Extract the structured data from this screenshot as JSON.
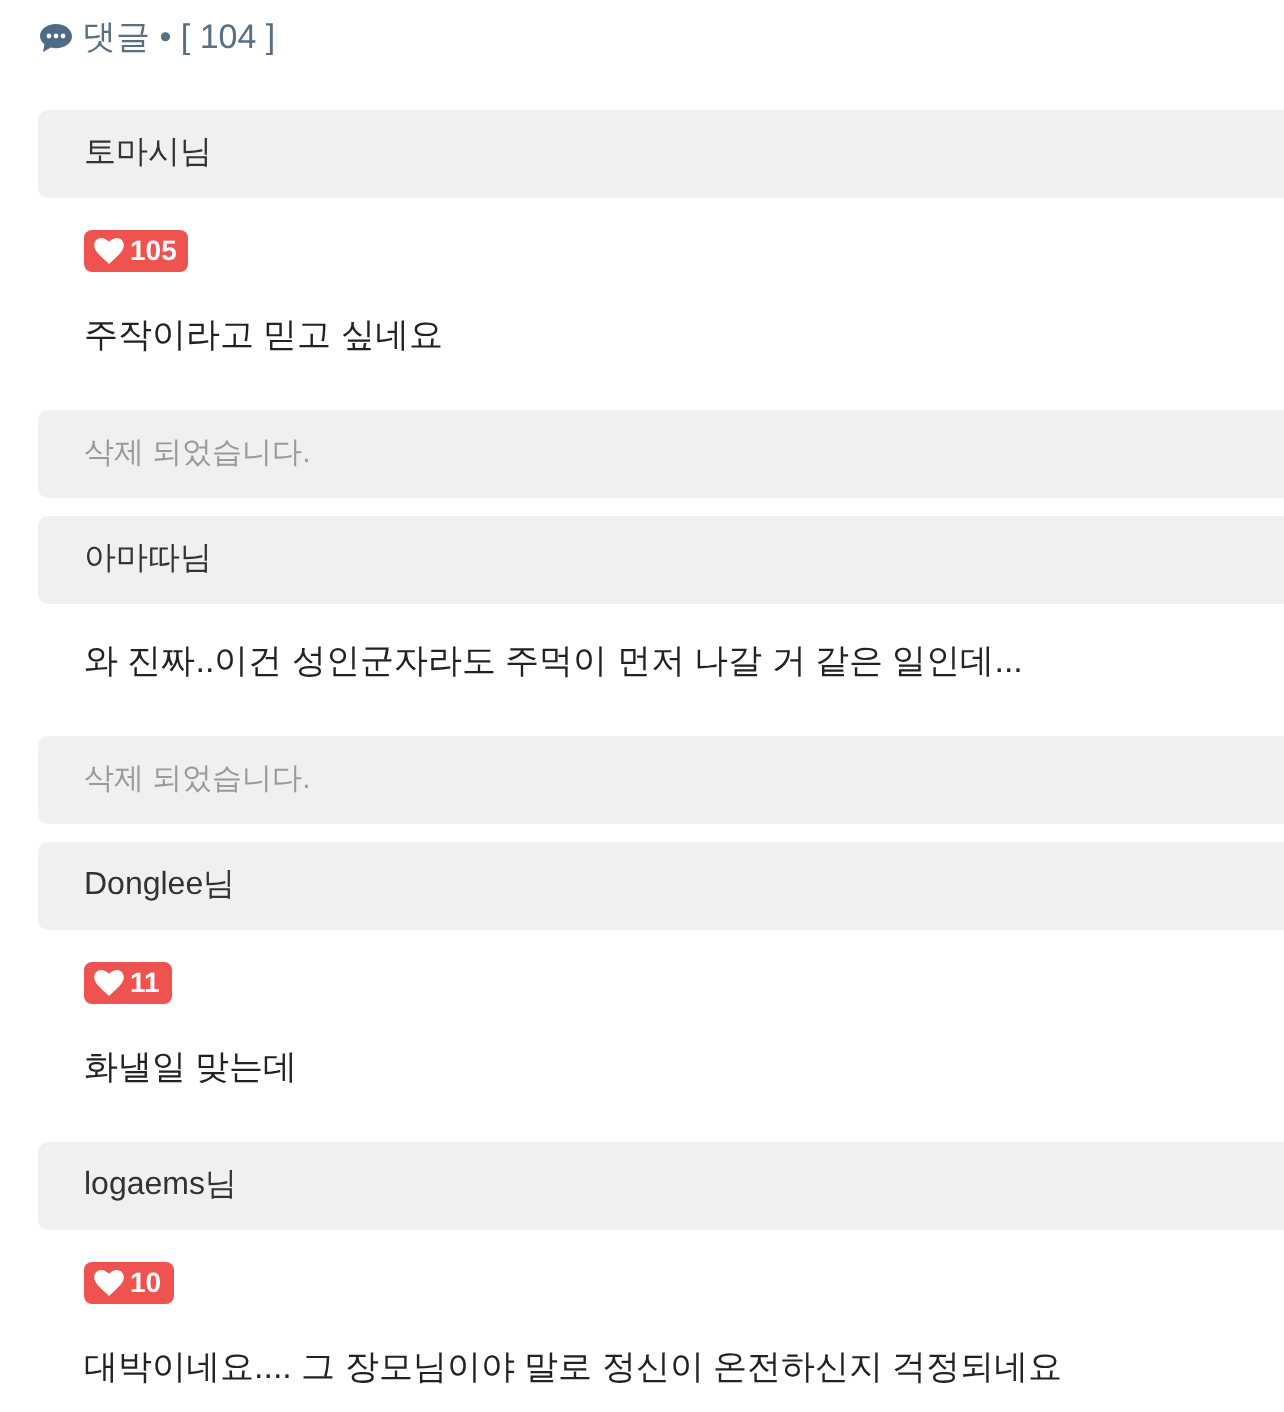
{
  "header": {
    "label": "댓글 • [ 104 ]"
  },
  "comments": [
    {
      "kind": "comment",
      "author": "토마시님",
      "likes": "105",
      "body": "주작이라고 믿고 싶네요"
    },
    {
      "kind": "deleted",
      "text": "삭제 되었습니다."
    },
    {
      "kind": "comment",
      "author": "아마따님",
      "body": "와 진짜..이건 성인군자라도 주먹이 먼저 나갈 거 같은 일인데..."
    },
    {
      "kind": "deleted",
      "text": "삭제 되었습니다."
    },
    {
      "kind": "comment",
      "author": "Donglee님",
      "likes": "11",
      "body": "화낼일 맞는데"
    },
    {
      "kind": "comment",
      "author": "logaems님",
      "likes": "10",
      "body": "대박이네요.... 그 장모님이야 말로 정신이 온전하신지 걱정되네요"
    }
  ]
}
